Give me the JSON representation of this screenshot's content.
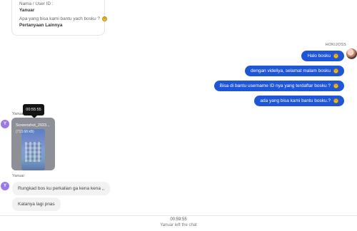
{
  "info_card": {
    "user_label": "Nama / User ID :",
    "user_value": "Yanuar",
    "question": "Apa yang bisa kami bantu yach bosku ?",
    "link": "Pertanyaan Lainnya"
  },
  "agent": {
    "name": "HOKIJOSS",
    "messages": [
      "Halo bosku",
      "dengan videliya, selamat malam bosku",
      "Bisa di bantu username ID nya yang terdaftar bosku ?",
      "ada yang bisa kami bantu bosku.?"
    ]
  },
  "user": {
    "name": "Yanuar",
    "avatar_letter": "Y",
    "tooltip_time": "00:55:55",
    "attachment": {
      "file_name": "Screenshot_2023...",
      "file_size": "(713.68 kB)"
    },
    "messages": [
      "Rungkad bos ku perkalian ga kena kena ,,",
      "Katanya lagi pnas"
    ]
  },
  "system": {
    "time": "00:59:55",
    "message": "Yanuar left the chat"
  },
  "icons": {
    "emoji": "smiling-face-icon"
  },
  "colors": {
    "agent_bubble": "#1f56d8",
    "user_bubble": "#f2f2f2",
    "avatar": "#9a7ae6"
  }
}
